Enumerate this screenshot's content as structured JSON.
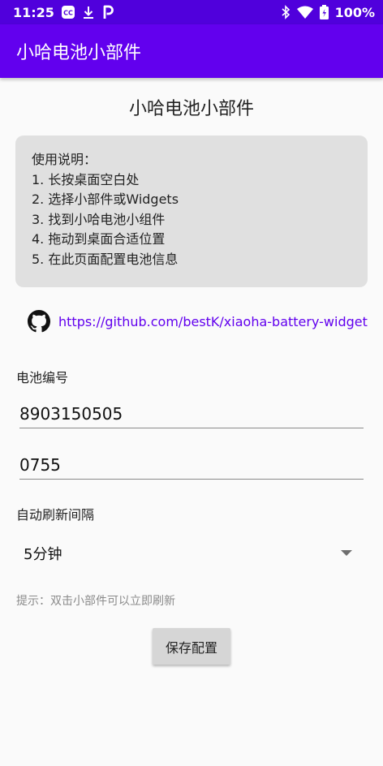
{
  "status_bar": {
    "time": "11:25",
    "battery_percent": "100%",
    "left_icons": [
      "captions-icon",
      "download-icon",
      "p-app-icon"
    ],
    "right_icons": [
      "bluetooth-icon",
      "wifi-icon",
      "battery-icon"
    ]
  },
  "app_bar": {
    "title": "小哈电池小部件",
    "color": "#6200ee",
    "status_color": "#5000dc"
  },
  "page": {
    "title": "小哈电池小部件"
  },
  "instructions": {
    "heading": "使用说明：",
    "steps": [
      "1. 长按桌面空白处",
      "2. 选择小部件或Widgets",
      "3. 找到小哈电池小组件",
      "4. 拖动到桌面合适位置",
      "5. 在此页面配置电池信息"
    ]
  },
  "github": {
    "icon": "github-icon",
    "link_text": "https://github.com/bestK/xiaoha-battery-widget"
  },
  "form": {
    "battery_label": "电池编号",
    "battery_number": "8903150505",
    "area_code": "0755",
    "refresh_label": "自动刷新间隔",
    "refresh_selected": "5分钟",
    "hint": "提示：双击小部件可以立即刷新",
    "save_label": "保存配置"
  }
}
